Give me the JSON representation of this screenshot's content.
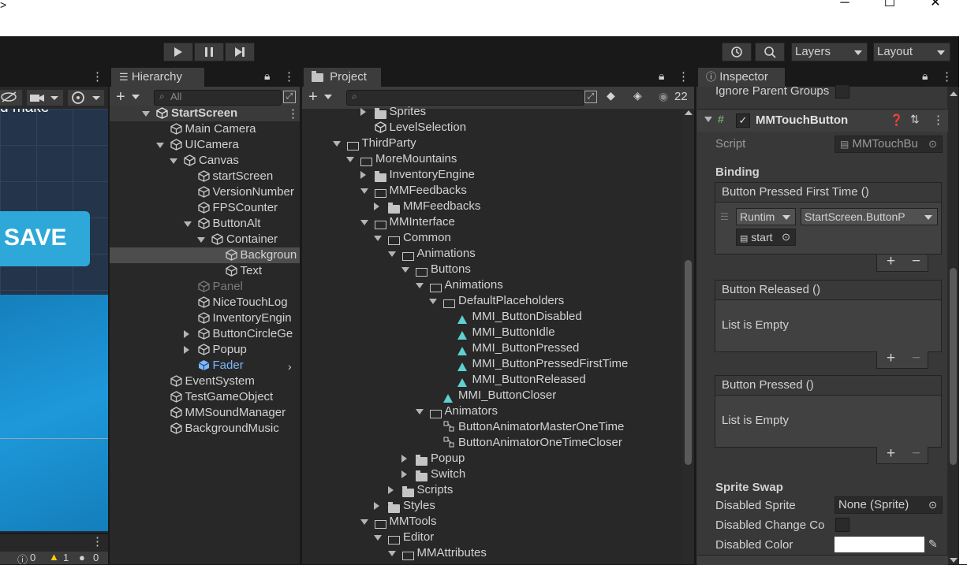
{
  "window": {
    "minimize": "─",
    "maximize": "☐",
    "close": "✕",
    "left_glyph": ">"
  },
  "toolbar": {
    "layers_label": "Layers",
    "layout_label": "Layout",
    "play": "▶",
    "pause": "❚❚",
    "step": "▶|"
  },
  "scene": {
    "partial_text": "d make",
    "save_text": "SAVE",
    "status_counts": [
      "0",
      "1",
      "0"
    ]
  },
  "hierarchy": {
    "tab_label": "Hierarchy",
    "search_placeholder": "All",
    "items": [
      {
        "label": "StartScreen",
        "depth": 0,
        "expand": "down",
        "icon": "unity-logo-icon",
        "bold": true
      },
      {
        "label": "Main Camera",
        "depth": 1,
        "expand": "none",
        "icon": "gameobject-icon"
      },
      {
        "label": "UICamera",
        "depth": 1,
        "expand": "down",
        "icon": "gameobject-icon"
      },
      {
        "label": "Canvas",
        "depth": 2,
        "expand": "down",
        "icon": "gameobject-icon"
      },
      {
        "label": "startScreen",
        "depth": 3,
        "expand": "none",
        "icon": "gameobject-icon"
      },
      {
        "label": "VersionNumber",
        "depth": 3,
        "expand": "none",
        "icon": "gameobject-icon"
      },
      {
        "label": "FPSCounter",
        "depth": 3,
        "expand": "none",
        "icon": "gameobject-icon"
      },
      {
        "label": "ButtonAlt",
        "depth": 3,
        "expand": "down",
        "icon": "gameobject-icon"
      },
      {
        "label": "Container",
        "depth": 4,
        "expand": "down",
        "icon": "gameobject-icon"
      },
      {
        "label": "Backgroun",
        "depth": 5,
        "expand": "none",
        "icon": "gameobject-icon",
        "selected": true
      },
      {
        "label": "Text",
        "depth": 5,
        "expand": "none",
        "icon": "gameobject-icon"
      },
      {
        "label": "Panel",
        "depth": 3,
        "expand": "none",
        "icon": "gameobject-icon",
        "dim": true
      },
      {
        "label": "NiceTouchLog",
        "depth": 3,
        "expand": "none",
        "icon": "gameobject-icon"
      },
      {
        "label": "InventoryEngin",
        "depth": 3,
        "expand": "none",
        "icon": "gameobject-icon"
      },
      {
        "label": "ButtonCircleGe",
        "depth": 3,
        "expand": "right",
        "icon": "gameobject-icon"
      },
      {
        "label": "Popup",
        "depth": 3,
        "expand": "right",
        "icon": "gameobject-icon"
      },
      {
        "label": "Fader",
        "depth": 3,
        "expand": "none",
        "icon": "prefab-icon",
        "prefab": true
      },
      {
        "label": "EventSystem",
        "depth": 1,
        "expand": "none",
        "icon": "gameobject-icon"
      },
      {
        "label": "TestGameObject",
        "depth": 1,
        "expand": "none",
        "icon": "gameobject-icon"
      },
      {
        "label": "MMSoundManager",
        "depth": 1,
        "expand": "none",
        "icon": "gameobject-icon"
      },
      {
        "label": "BackgroundMusic",
        "depth": 1,
        "expand": "none",
        "icon": "gameobject-icon"
      }
    ]
  },
  "project": {
    "tab_label": "Project",
    "hidden_count": "22",
    "items": [
      {
        "label": "Sprites",
        "depth": 3,
        "expand": "right",
        "icon": "folder"
      },
      {
        "label": "LevelSelection",
        "depth": 3,
        "expand": "none",
        "icon": "scene"
      },
      {
        "label": "ThirdParty",
        "depth": 1,
        "expand": "down",
        "icon": "ofolder"
      },
      {
        "label": "MoreMountains",
        "depth": 2,
        "expand": "down",
        "icon": "ofolder"
      },
      {
        "label": "InventoryEngine",
        "depth": 3,
        "expand": "right",
        "icon": "folder"
      },
      {
        "label": "MMFeedbacks",
        "depth": 3,
        "expand": "down",
        "icon": "ofolder"
      },
      {
        "label": "MMFeedbacks",
        "depth": 4,
        "expand": "right",
        "icon": "folder"
      },
      {
        "label": "MMInterface",
        "depth": 3,
        "expand": "down",
        "icon": "ofolder"
      },
      {
        "label": "Common",
        "depth": 4,
        "expand": "down",
        "icon": "ofolder"
      },
      {
        "label": "Animations",
        "depth": 5,
        "expand": "down",
        "icon": "ofolder"
      },
      {
        "label": "Buttons",
        "depth": 6,
        "expand": "down",
        "icon": "ofolder"
      },
      {
        "label": "Animations",
        "depth": 7,
        "expand": "down",
        "icon": "ofolder"
      },
      {
        "label": "DefaultPlaceholders",
        "depth": 8,
        "expand": "down",
        "icon": "ofolder"
      },
      {
        "label": "MMI_ButtonDisabled",
        "depth": 9,
        "expand": "none",
        "icon": "anim"
      },
      {
        "label": "MMI_ButtonIdle",
        "depth": 9,
        "expand": "none",
        "icon": "anim"
      },
      {
        "label": "MMI_ButtonPressed",
        "depth": 9,
        "expand": "none",
        "icon": "anim"
      },
      {
        "label": "MMI_ButtonPressedFirstTime",
        "depth": 9,
        "expand": "none",
        "icon": "anim"
      },
      {
        "label": "MMI_ButtonReleased",
        "depth": 9,
        "expand": "none",
        "icon": "anim"
      },
      {
        "label": "MMI_ButtonCloser",
        "depth": 8,
        "expand": "none",
        "icon": "anim"
      },
      {
        "label": "Animators",
        "depth": 7,
        "expand": "down",
        "icon": "ofolder"
      },
      {
        "label": "ButtonAnimatorMasterOneTime",
        "depth": 8,
        "expand": "none",
        "icon": "animator"
      },
      {
        "label": "ButtonAnimatorOneTimeCloser",
        "depth": 8,
        "expand": "none",
        "icon": "animator"
      },
      {
        "label": "Popup",
        "depth": 6,
        "expand": "right",
        "icon": "folder"
      },
      {
        "label": "Switch",
        "depth": 6,
        "expand": "right",
        "icon": "folder"
      },
      {
        "label": "Scripts",
        "depth": 5,
        "expand": "right",
        "icon": "folder"
      },
      {
        "label": "Styles",
        "depth": 4,
        "expand": "right",
        "icon": "folder"
      },
      {
        "label": "MMTools",
        "depth": 3,
        "expand": "down",
        "icon": "ofolder"
      },
      {
        "label": "Editor",
        "depth": 4,
        "expand": "down",
        "icon": "ofolder"
      },
      {
        "label": "MMAttributes",
        "depth": 5,
        "expand": "down",
        "icon": "ofolder"
      }
    ]
  },
  "inspector": {
    "tab_label": "Inspector",
    "ignore_parent_groups": "Ignore Parent Groups",
    "component_name": "MMTouchButton",
    "script_label": "Script",
    "script_value": "MMTouchBu",
    "binding_header": "Binding",
    "event_pressed_first": "Button Pressed First Time ()",
    "runtime_dropdown": "Runtim",
    "function_dropdown": "StartScreen.ButtonP",
    "object_field": "start",
    "event_released": "Button Released ()",
    "list_empty_1": "List is Empty",
    "event_pressed": "Button Pressed ()",
    "list_empty_2": "List is Empty",
    "plus": "+",
    "minus": "−",
    "sprite_swap_header": "Sprite Swap",
    "disabled_sprite_label": "Disabled Sprite",
    "disabled_sprite_value": "None (Sprite)",
    "disabled_change_label": "Disabled Change Co",
    "disabled_color_label": "Disabled Color"
  },
  "colors": {
    "accent": "#2ea8d8",
    "selected_row": "#4d4d4d",
    "prefab_blue": "#7cb7ff",
    "scene_blue": "#1a8fd0"
  }
}
